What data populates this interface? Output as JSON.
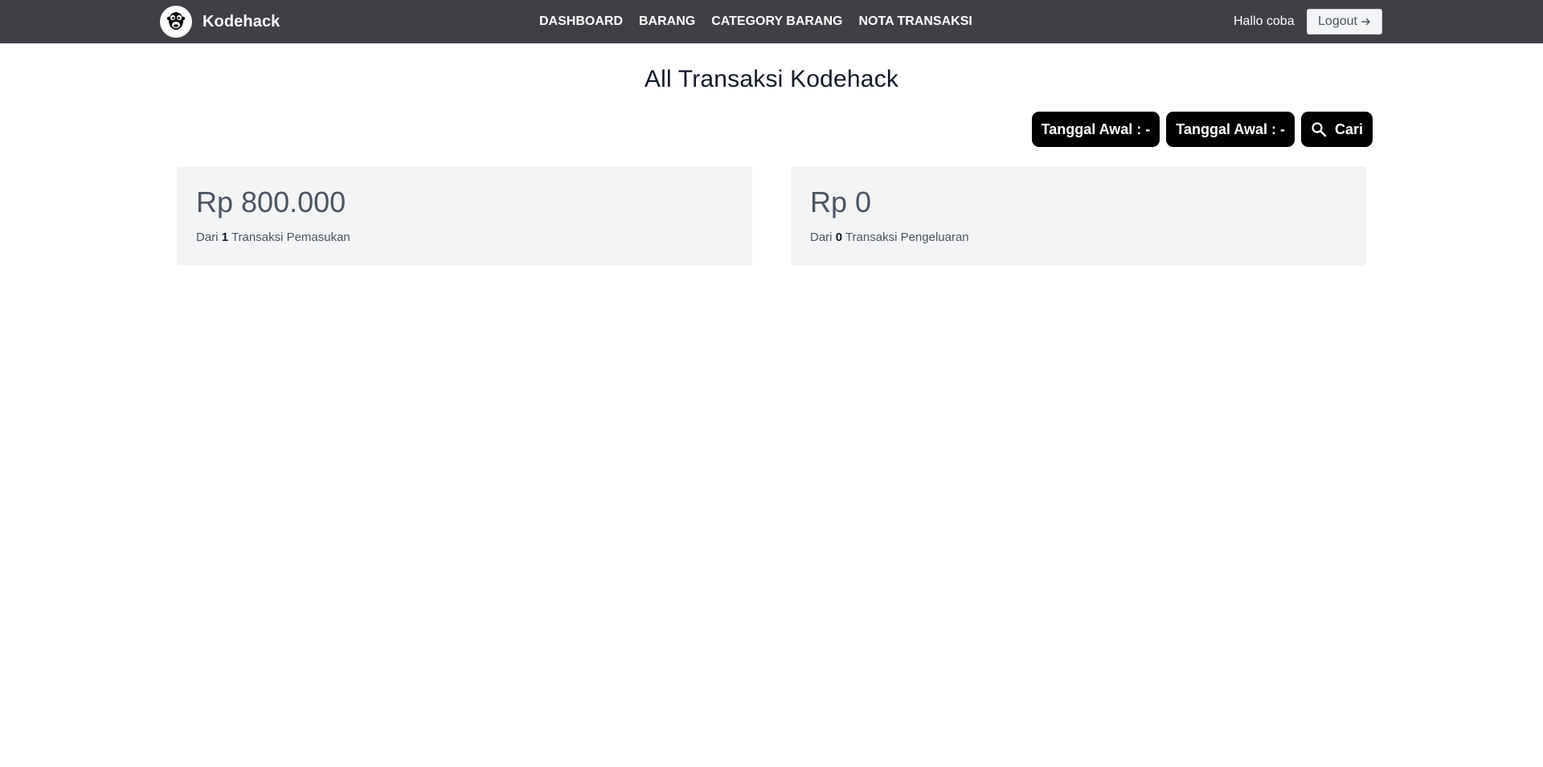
{
  "brand": {
    "name": "Kodehack",
    "logo_icon": "monkey-face-icon"
  },
  "nav": {
    "items": [
      {
        "label": "DASHBOARD"
      },
      {
        "label": "BARANG"
      },
      {
        "label": "CATEGORY BARANG"
      },
      {
        "label": "NOTA TRANSAKSI"
      }
    ]
  },
  "user": {
    "greeting": "Hallo coba",
    "logout_label": "Logout",
    "logout_icon": "arrow-right-icon"
  },
  "page": {
    "title": "All Transaksi Kodehack"
  },
  "filters": {
    "start_date_label": "Tanggal Awal : -",
    "end_date_label": "Tanggal Awal : -",
    "search_label": "Cari",
    "search_icon": "search-icon"
  },
  "summary": {
    "income": {
      "amount": "Rp 800.000",
      "prefix": "Dari",
      "count": "1",
      "suffix": "Transaksi Pemasukan"
    },
    "expense": {
      "amount": "Rp 0",
      "prefix": "Dari",
      "count": "0",
      "suffix": "Transaksi Pengeluaran"
    }
  },
  "colors": {
    "navbar": "#3f4046",
    "card_bg": "#f3f4f6",
    "button_bg": "#000000"
  }
}
